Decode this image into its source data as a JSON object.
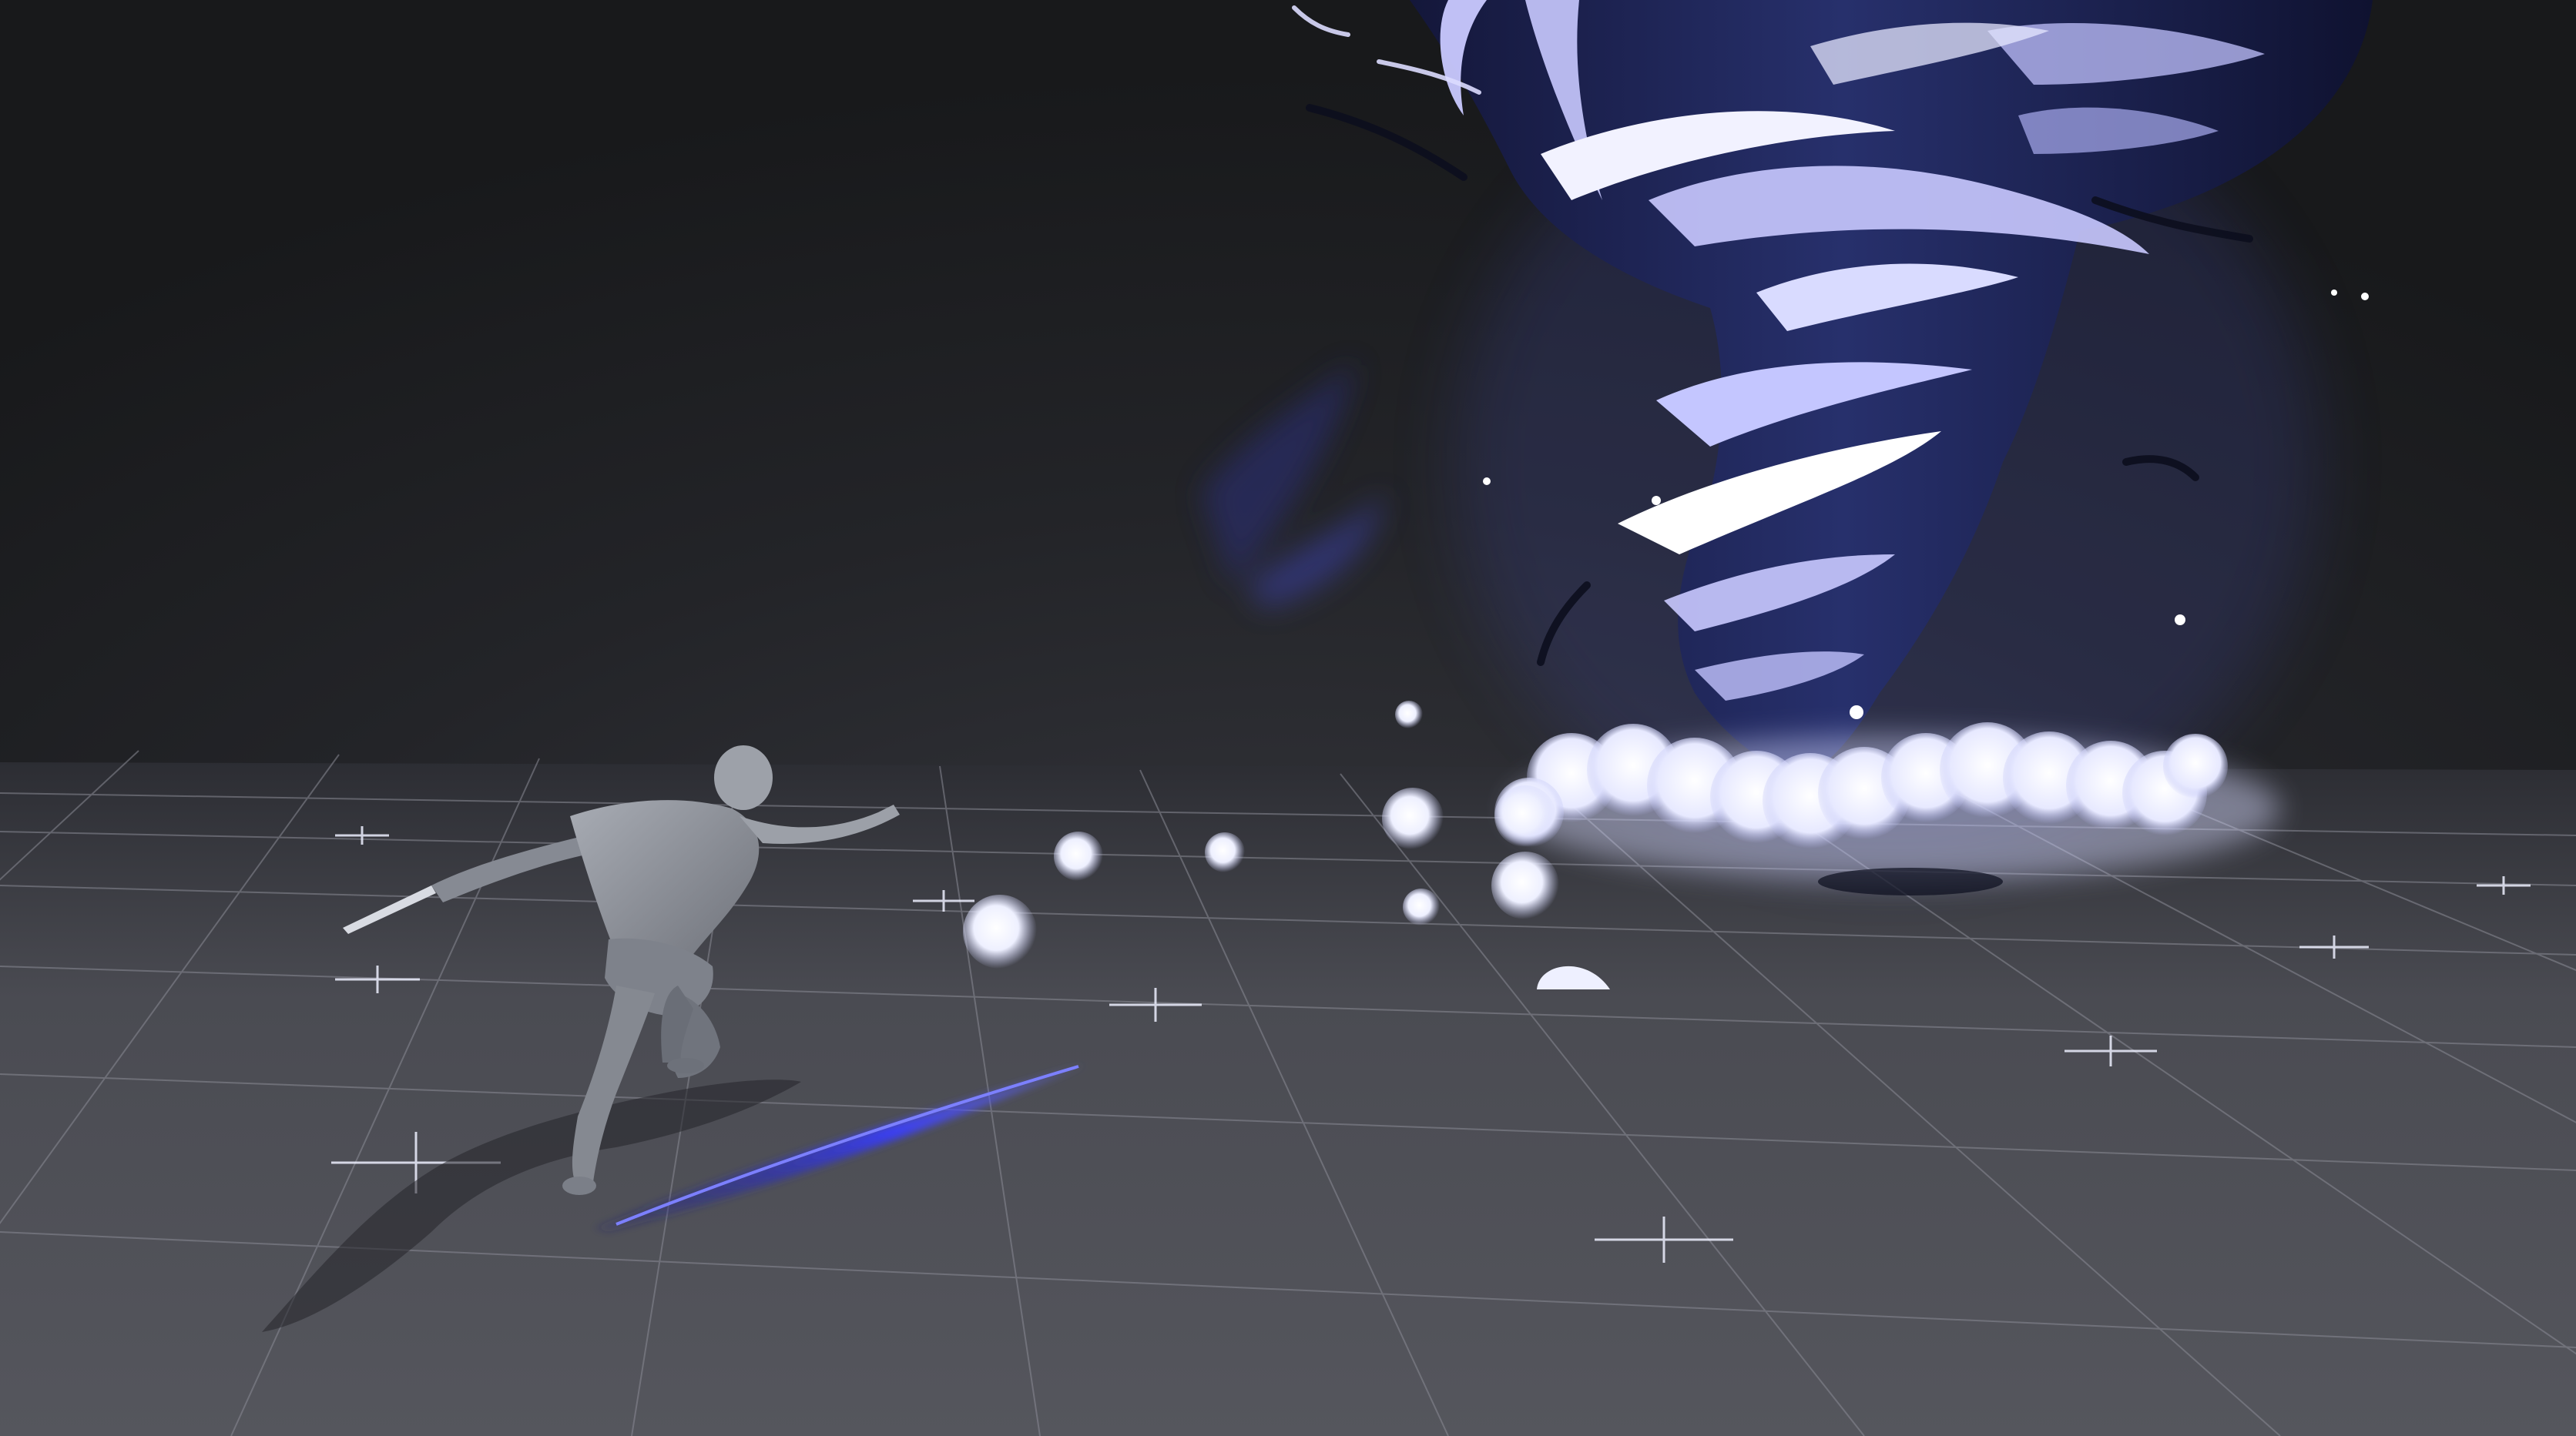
{
  "scene": {
    "kind": "3d-vfx-preview",
    "background_color": "#1b1c1f",
    "floor_color": "#4a4b52",
    "grid_line_color": "#8a8b95",
    "tornado_core_color": "#1b1f4a",
    "tornado_highlight_color": "#c9c9ff",
    "glow_color": "#eef0ff",
    "streak_color": "#2a2fd0",
    "mannequin_color": "#8f939c",
    "mannequin_shadow_color": "#60636c",
    "glowing_orb_count": 9,
    "dust_puff_count": 13,
    "grid_marker_count": 9
  }
}
